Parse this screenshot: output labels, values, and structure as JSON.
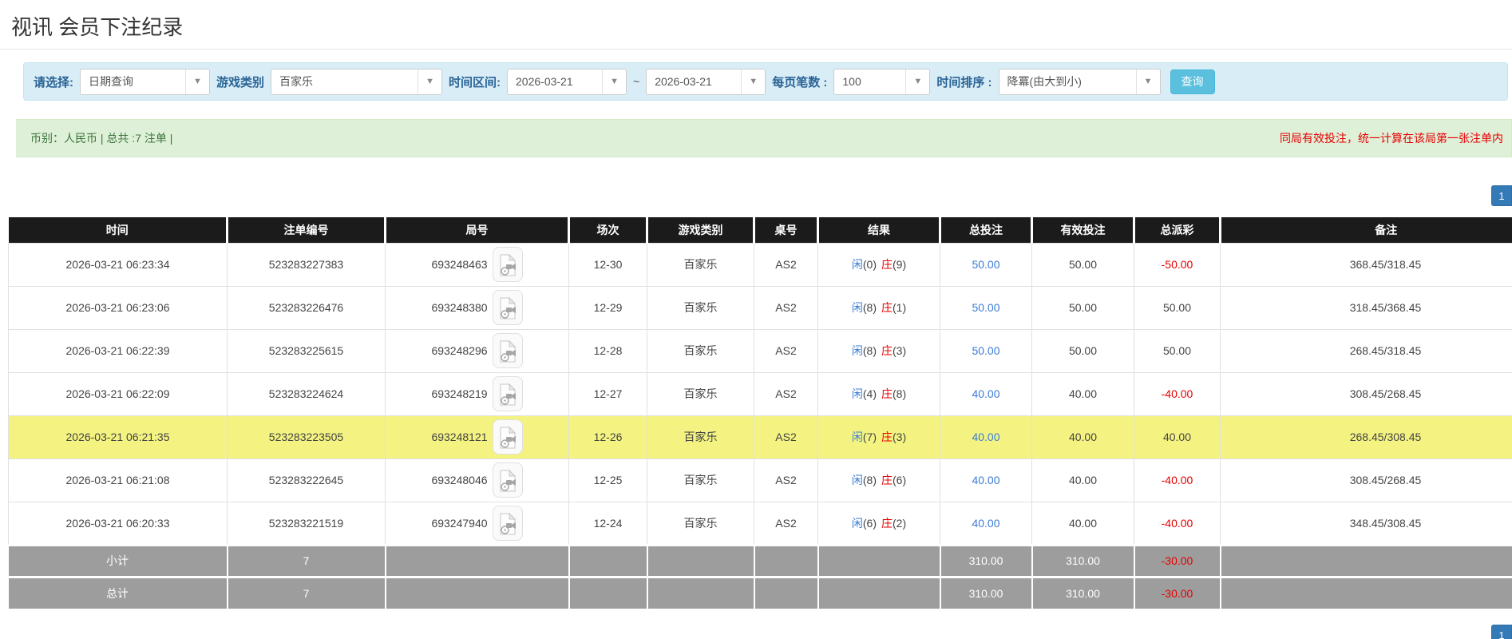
{
  "page": {
    "title": "视讯 会员下注纪录"
  },
  "icons": {
    "dropdown_arrow": "▼",
    "video_icon": "video-playback"
  },
  "filters": {
    "select_type": {
      "label": "请选择:",
      "value": "日期查询"
    },
    "game_category": {
      "label": "游戏类别",
      "value": "百家乐"
    },
    "time_range": {
      "label": "时间区间:",
      "from": "2026-03-21",
      "separator": "~",
      "to": "2026-03-21"
    },
    "page_size": {
      "label": "每页笔数 :",
      "value": "100"
    },
    "time_sort": {
      "label": "时间排序 :",
      "value": "降冪(由大到小)"
    },
    "search_button": "查询"
  },
  "summary": {
    "left": "币别：人民币 | 总共 :7 注单 |",
    "right_note": "同局有效投注，统一计算在该局第一张注单内"
  },
  "pagination": {
    "page": "1"
  },
  "table": {
    "headers": [
      "时间",
      "注单编号",
      "局号",
      "场次",
      "游戏类别",
      "桌号",
      "结果",
      "总投注",
      "有效投注",
      "总派彩",
      "备注"
    ],
    "rows": [
      {
        "time": "2026-03-21 06:23:34",
        "bet_no": "523283227383",
        "round_no": "693248463",
        "session": "12-30",
        "game": "百家乐",
        "table_no": "AS2",
        "result_p": "闲",
        "result_pv": "(0)",
        "result_b": "庄",
        "result_bv": "(9)",
        "total_bet": "50.00",
        "valid_bet": "50.00",
        "payout": "-50.00",
        "note": "368.45/318.45",
        "highlight": false
      },
      {
        "time": "2026-03-21 06:23:06",
        "bet_no": "523283226476",
        "round_no": "693248380",
        "session": "12-29",
        "game": "百家乐",
        "table_no": "AS2",
        "result_p": "闲",
        "result_pv": "(8)",
        "result_b": "庄",
        "result_bv": "(1)",
        "total_bet": "50.00",
        "valid_bet": "50.00",
        "payout": "50.00",
        "note": "318.45/368.45",
        "highlight": false
      },
      {
        "time": "2026-03-21 06:22:39",
        "bet_no": "523283225615",
        "round_no": "693248296",
        "session": "12-28",
        "game": "百家乐",
        "table_no": "AS2",
        "result_p": "闲",
        "result_pv": "(8)",
        "result_b": "庄",
        "result_bv": "(3)",
        "total_bet": "50.00",
        "valid_bet": "50.00",
        "payout": "50.00",
        "note": "268.45/318.45",
        "highlight": false
      },
      {
        "time": "2026-03-21 06:22:09",
        "bet_no": "523283224624",
        "round_no": "693248219",
        "session": "12-27",
        "game": "百家乐",
        "table_no": "AS2",
        "result_p": "闲",
        "result_pv": "(4)",
        "result_b": "庄",
        "result_bv": "(8)",
        "total_bet": "40.00",
        "valid_bet": "40.00",
        "payout": "-40.00",
        "note": "308.45/268.45",
        "highlight": false
      },
      {
        "time": "2026-03-21 06:21:35",
        "bet_no": "523283223505",
        "round_no": "693248121",
        "session": "12-26",
        "game": "百家乐",
        "table_no": "AS2",
        "result_p": "闲",
        "result_pv": "(7)",
        "result_b": "庄",
        "result_bv": "(3)",
        "total_bet": "40.00",
        "valid_bet": "40.00",
        "payout": "40.00",
        "note": "268.45/308.45",
        "highlight": true
      },
      {
        "time": "2026-03-21 06:21:08",
        "bet_no": "523283222645",
        "round_no": "693248046",
        "session": "12-25",
        "game": "百家乐",
        "table_no": "AS2",
        "result_p": "闲",
        "result_pv": "(8)",
        "result_b": "庄",
        "result_bv": "(6)",
        "total_bet": "40.00",
        "valid_bet": "40.00",
        "payout": "-40.00",
        "note": "308.45/268.45",
        "highlight": false
      },
      {
        "time": "2026-03-21 06:20:33",
        "bet_no": "523283221519",
        "round_no": "693247940",
        "session": "12-24",
        "game": "百家乐",
        "table_no": "AS2",
        "result_p": "闲",
        "result_pv": "(6)",
        "result_b": "庄",
        "result_bv": "(2)",
        "total_bet": "40.00",
        "valid_bet": "40.00",
        "payout": "-40.00",
        "note": "348.45/308.45",
        "highlight": false
      }
    ],
    "footer": [
      {
        "label": "小计",
        "count": "7",
        "total_bet": "310.00",
        "valid_bet": "310.00",
        "payout": "-30.00"
      },
      {
        "label": "总计",
        "count": "7",
        "total_bet": "310.00",
        "valid_bet": "310.00",
        "payout": "-30.00"
      }
    ]
  },
  "colors": {
    "filter_bg": "#d9edf7",
    "accent_blue": "#5bc0de",
    "link_blue": "#3a7bd5",
    "negative_red": "#e60000",
    "header_bg": "#1b1b1b",
    "highlight_yellow": "#f4f382",
    "footer_gray": "#9d9d9d",
    "info_green_bg": "#dff0d8",
    "info_green_text": "#3c763d",
    "pager_blue": "#337ab7"
  }
}
